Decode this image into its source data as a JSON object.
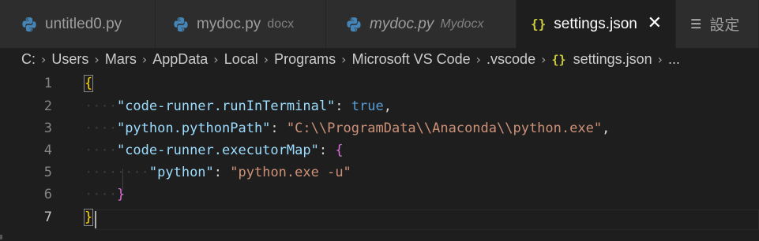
{
  "tabs": [
    {
      "label": "untitled0.py",
      "desc": ""
    },
    {
      "label": "mydoc.py",
      "desc": "docx"
    },
    {
      "label": "mydoc.py",
      "desc": "Mydocx"
    },
    {
      "label": "settings.json",
      "desc": ""
    },
    {
      "label": "設定",
      "desc": ""
    }
  ],
  "close_glyph": "✕",
  "json_glyph": "{}",
  "breadcrumb": {
    "items": [
      "C:",
      "Users",
      "Mars",
      "AppData",
      "Local",
      "Programs",
      "Microsoft VS Code",
      ".vscode",
      "settings.json",
      "..."
    ]
  },
  "editor": {
    "line_numbers": [
      "1",
      "2",
      "3",
      "4",
      "5",
      "6",
      "7"
    ],
    "lines": [
      {
        "indent": "",
        "key": "",
        "colon": "",
        "value": "",
        "tail": "",
        "open": "{"
      },
      {
        "indent": "····",
        "key": "\"code-runner.runInTerminal\"",
        "colon": ": ",
        "value": "true",
        "tail": ","
      },
      {
        "indent": "····",
        "key": "\"python.pythonPath\"",
        "colon": ": ",
        "value": "\"C:\\\\ProgramData\\\\Anaconda\\\\python.exe\"",
        "tail": ","
      },
      {
        "indent": "····",
        "key": "\"code-runner.executorMap\"",
        "colon": ": ",
        "value": "{",
        "tail": ""
      },
      {
        "indent": "········",
        "key": "\"python\"",
        "colon": ": ",
        "value": "\"python.exe -u\"",
        "tail": ""
      },
      {
        "indent": "····",
        "key": "",
        "colon": "",
        "value": "}",
        "tail": ""
      },
      {
        "indent": "",
        "key": "",
        "colon": "",
        "value": "}",
        "tail": ""
      }
    ]
  },
  "colors": {
    "background": "#1e1e1e",
    "tab_bar": "#252526",
    "key": "#9cdcfe",
    "string": "#ce9178",
    "boolean": "#569cd6",
    "brace_level1": "#ffd700",
    "brace_level2": "#da70d6",
    "python_icon": "#4584b6"
  }
}
